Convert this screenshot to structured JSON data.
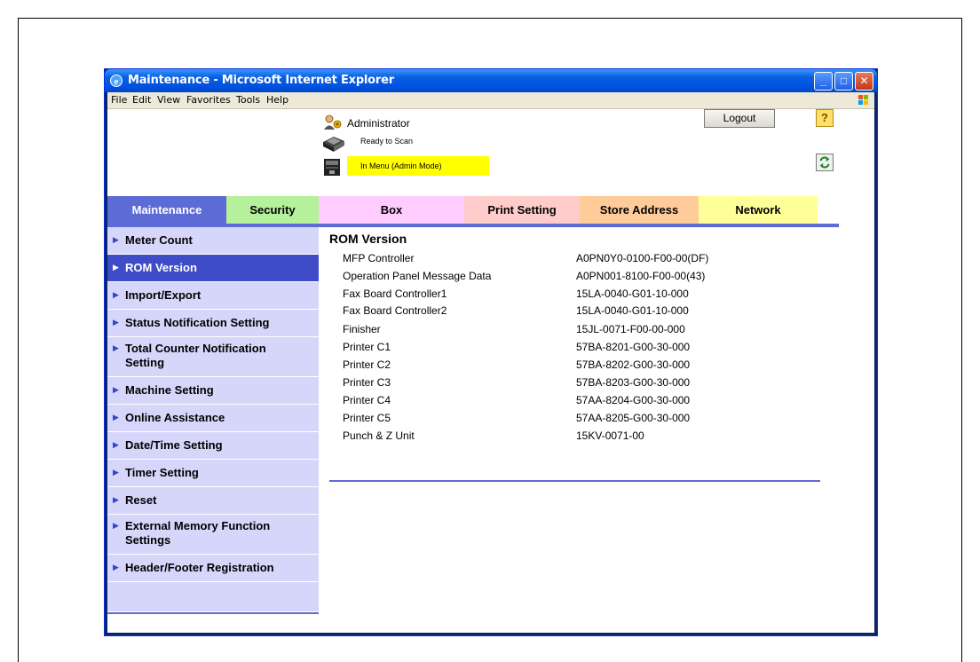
{
  "window": {
    "title": "Maintenance - Microsoft Internet Explorer",
    "buttons": {
      "minimize": "_",
      "maximize": "□",
      "close": "✕"
    }
  },
  "menubar": [
    "File",
    "Edit",
    "View",
    "Favorites",
    "Tools",
    "Help"
  ],
  "header": {
    "user_label": "Administrator",
    "logout_label": "Logout",
    "help_label": "?",
    "status_ready": "Ready to Scan",
    "status_mode": "In Menu (Admin Mode)"
  },
  "tabs": [
    {
      "label": "Maintenance",
      "bg": "#5c6bd6",
      "fg": "#ffffff"
    },
    {
      "label": "Security",
      "bg": "#b5f09a",
      "fg": "#000000"
    },
    {
      "label": "Box",
      "bg": "#ffccff",
      "fg": "#000000"
    },
    {
      "label": "Print Setting",
      "bg": "#ffcccc",
      "fg": "#000000"
    },
    {
      "label": "Store Address",
      "bg": "#ffcc99",
      "fg": "#000000"
    },
    {
      "label": "Network",
      "bg": "#ffff99",
      "fg": "#000000"
    }
  ],
  "sidebar": {
    "items": [
      {
        "label": "Meter Count"
      },
      {
        "label": "ROM Version",
        "active": true
      },
      {
        "label": "Import/Export"
      },
      {
        "label": "Status Notification Setting"
      },
      {
        "label": "Total Counter Notification Setting"
      },
      {
        "label": "Machine Setting"
      },
      {
        "label": "Online Assistance"
      },
      {
        "label": "Date/Time Setting"
      },
      {
        "label": "Timer Setting"
      },
      {
        "label": "Reset"
      },
      {
        "label": "External Memory Function Settings"
      },
      {
        "label": "Header/Footer Registration"
      }
    ]
  },
  "main": {
    "title": "ROM Version",
    "rows": [
      {
        "name": "MFP Controller",
        "value": "A0PN0Y0-0100-F00-00(DF)"
      },
      {
        "name": "Operation Panel Message Data",
        "value": "A0PN001-8100-F00-00(43)"
      },
      {
        "name": "Fax Board Controller1",
        "value": "15LA-0040-G01-10-000"
      },
      {
        "name": "Fax Board Controller2",
        "value": "15LA-0040-G01-10-000"
      },
      {
        "name": "Finisher",
        "value": "15JL-0071-F00-00-000"
      },
      {
        "name": "Printer C1",
        "value": "57BA-8201-G00-30-000"
      },
      {
        "name": "Printer C2",
        "value": "57BA-8202-G00-30-000"
      },
      {
        "name": "Printer C3",
        "value": "57BA-8203-G00-30-000"
      },
      {
        "name": "Printer C4",
        "value": "57AA-8204-G00-30-000"
      },
      {
        "name": "Printer C5",
        "value": "57AA-8205-G00-30-000"
      },
      {
        "name": "Punch & Z Unit",
        "value": "15KV-0071-00"
      }
    ]
  }
}
